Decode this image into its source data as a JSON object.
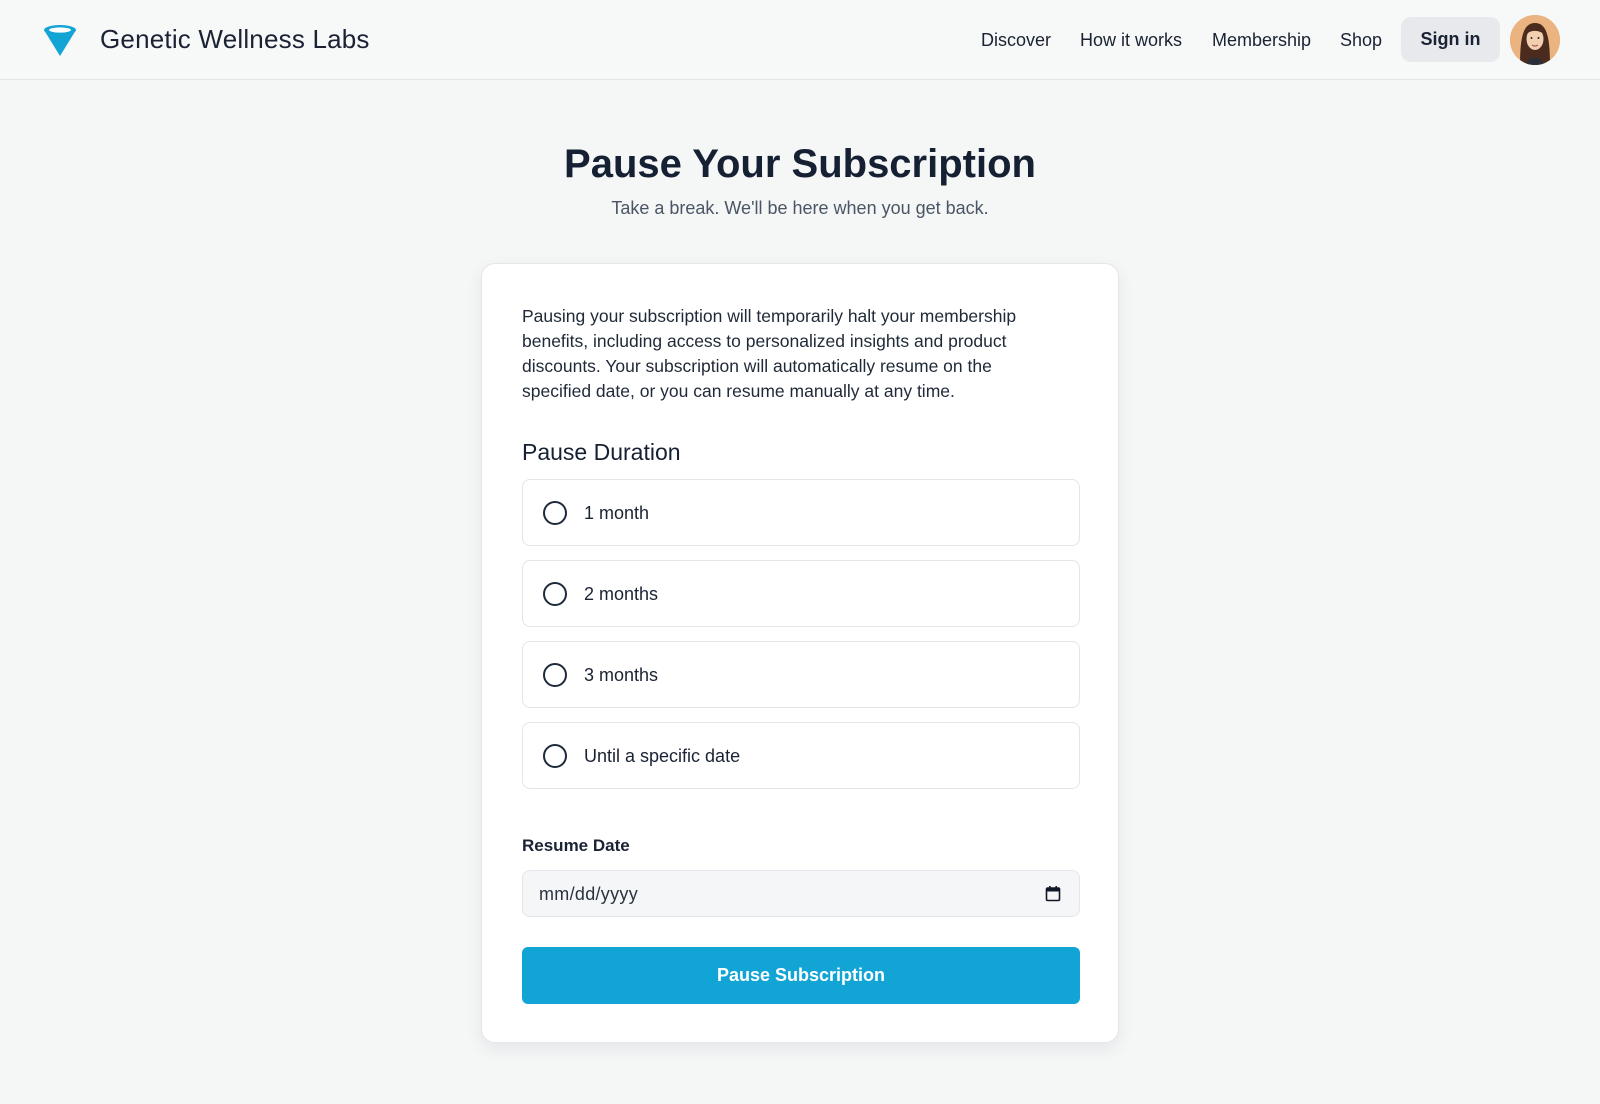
{
  "header": {
    "brand": "Genetic Wellness Labs",
    "logo_icon": "funnel-cone-icon",
    "nav": [
      {
        "label": "Discover"
      },
      {
        "label": "How it works"
      },
      {
        "label": "Membership"
      },
      {
        "label": "Shop"
      }
    ],
    "signin_label": "Sign in",
    "avatar_icon": "user-avatar"
  },
  "hero": {
    "title": "Pause Your Subscription",
    "subtitle": "Take a break. We'll be here when you get back."
  },
  "card": {
    "intro": "Pausing your subscription will temporarily halt your membership benefits, including access to personalized insights and product discounts. Your subscription will automatically resume on the specified date, or you can resume manually at any time.",
    "duration_heading": "Pause Duration",
    "options": [
      {
        "label": "1 month",
        "selected": false
      },
      {
        "label": "2 months",
        "selected": false
      },
      {
        "label": "3 months",
        "selected": false
      },
      {
        "label": "Until a specific date",
        "selected": false
      }
    ],
    "resume_label": "Resume Date",
    "date_placeholder": "mm/dd/yyyy",
    "submit_label": "Pause Subscription"
  },
  "colors": {
    "accent": "#13a4d6",
    "page_bg": "#f5f7f7",
    "text": "#1a2233"
  }
}
